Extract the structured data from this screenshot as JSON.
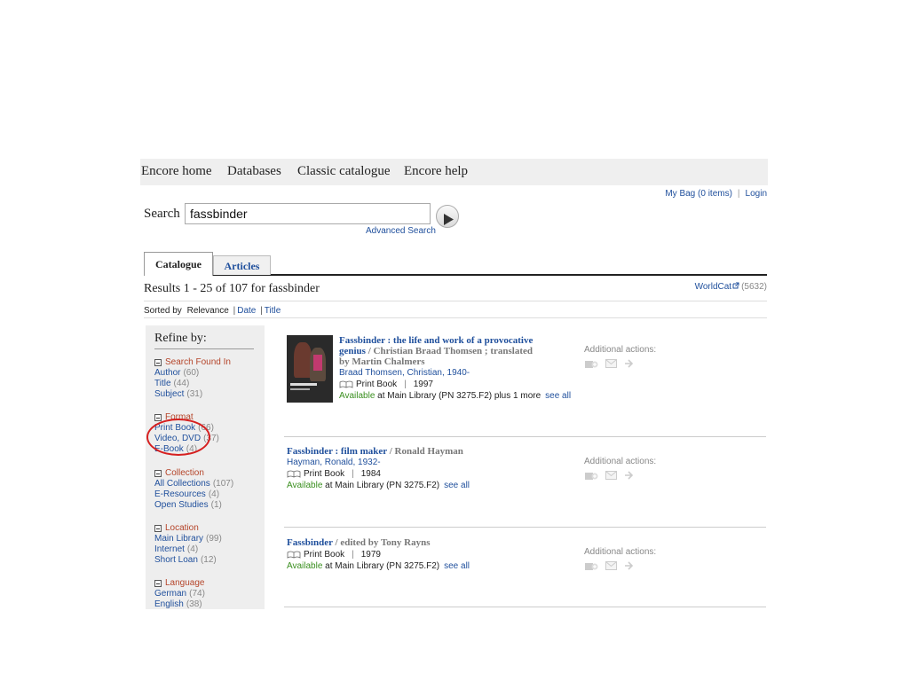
{
  "nav": {
    "items": [
      "Encore home",
      "Databases",
      "Classic catalogue",
      "Encore help"
    ]
  },
  "account": {
    "bag": "My Bag (0 items)",
    "login": "Login"
  },
  "search": {
    "label": "Search",
    "value": "fassbinder",
    "advanced": "Advanced Search"
  },
  "tabs": {
    "catalogue": "Catalogue",
    "articles": "Articles"
  },
  "results": {
    "summary": "Results 1 - 25 of 107 for fassbinder",
    "worldcat_label": "WorldCat",
    "worldcat_count": "(5632)"
  },
  "sort": {
    "label": "Sorted by",
    "relevance": "Relevance",
    "date": "Date",
    "title": "Title"
  },
  "refine": {
    "title": "Refine by:",
    "groups": [
      {
        "name": "Search Found In",
        "items": [
          {
            "label": "Author",
            "count": "(60)"
          },
          {
            "label": "Title",
            "count": "(44)"
          },
          {
            "label": "Subject",
            "count": "(31)"
          }
        ]
      },
      {
        "name": "Format",
        "items": [
          {
            "label": "Print Book",
            "count": "(66)"
          },
          {
            "label": "Video, DVD",
            "count": "(37)"
          },
          {
            "label": "E-Book",
            "count": "(4)"
          }
        ]
      },
      {
        "name": "Collection",
        "items": [
          {
            "label": "All Collections",
            "count": "(107)"
          },
          {
            "label": "E-Resources",
            "count": "(4)"
          },
          {
            "label": "Open Studies",
            "count": "(1)"
          }
        ]
      },
      {
        "name": "Location",
        "items": [
          {
            "label": "Main Library",
            "count": "(99)"
          },
          {
            "label": "Internet",
            "count": "(4)"
          },
          {
            "label": "Short Loan",
            "count": "(12)"
          }
        ]
      },
      {
        "name": "Language",
        "items": [
          {
            "label": "German",
            "count": "(74)"
          },
          {
            "label": "English",
            "count": "(38)"
          }
        ]
      }
    ]
  },
  "items": [
    {
      "title_main": "Fassbinder : the life and work of a provocative",
      "title_main2": "genius",
      "title_resp": " / Christian Braad Thomsen ; translated",
      "title_resp2": "by Martin Chalmers",
      "author": "Braad Thomsen, Christian, 1940-",
      "format": "Print Book",
      "year": "1997",
      "available": "Available",
      "location": " at Main Library (PN 3275.F2) plus 1 more",
      "see_all": "see all",
      "actions_label": "Additional actions:"
    },
    {
      "title_main": "Fassbinder : film maker",
      "title_resp": " / Ronald Hayman",
      "author": "Hayman, Ronald, 1932-",
      "format": "Print Book",
      "year": "1984",
      "available": "Available",
      "location": " at Main Library (PN 3275.F2)",
      "see_all": "see all",
      "actions_label": "Additional actions:"
    },
    {
      "title_main": "Fassbinder",
      "title_resp": " / edited by Tony Rayns",
      "format": "Print Book",
      "year": "1979",
      "available": "Available",
      "location": " at Main Library (PN 3275.F2)",
      "see_all": "see all",
      "actions_label": "Additional actions:"
    }
  ],
  "colors": {
    "link": "#1f4f9c",
    "facet_head": "#b5452a",
    "available": "#3a8f1f",
    "annotation": "#d62020"
  },
  "icons": [
    "play-arrow-icon",
    "external-link-icon",
    "book-icon",
    "add-to-bag-icon",
    "email-icon",
    "export-arrow-icon"
  ]
}
